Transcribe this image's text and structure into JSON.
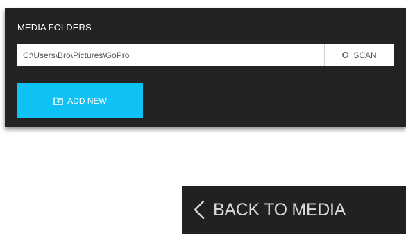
{
  "media_folders": {
    "title": "MEDIA FOLDERS",
    "folder_path": "C:\\Users\\Bro\\Pictures\\GoPro",
    "scan_label": "SCAN",
    "scan_icon": "refresh-icon",
    "add_new_label": "ADD NEW",
    "add_new_icon": "folder-plus-icon"
  },
  "back_nav": {
    "label": "BACK TO MEDIA",
    "icon": "chevron-left-icon"
  },
  "colors": {
    "panel_bg": "#232323",
    "accent": "#0ec2f6",
    "back_bar_bg": "#212121"
  }
}
